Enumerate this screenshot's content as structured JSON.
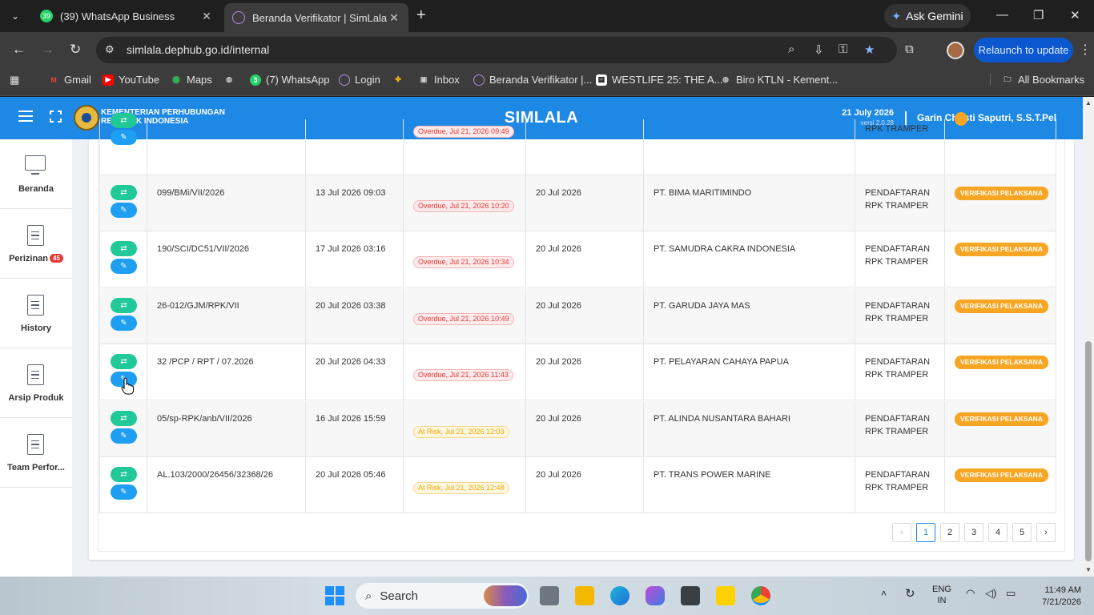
{
  "browser": {
    "tabs": [
      {
        "title": "(39) WhatsApp Business",
        "badge": "39",
        "active": false
      },
      {
        "title": "Beranda Verifikator | SimLala",
        "active": true
      }
    ],
    "gemini_label": "Ask Gemini",
    "url": "simlala.dephub.go.id/internal",
    "relaunch_label": "Relaunch to update",
    "bookmarks": [
      {
        "label": "Gmail",
        "icon": "gmail-icon"
      },
      {
        "label": "YouTube",
        "icon": "youtube-icon"
      },
      {
        "label": "Maps",
        "icon": "maps-icon"
      },
      {
        "label": "",
        "icon": "globe-icon"
      },
      {
        "label": "(7) WhatsApp",
        "icon": "whatsapp-icon"
      },
      {
        "label": "Login",
        "icon": "simlala-icon"
      },
      {
        "label": "",
        "icon": "pinwheel-icon"
      },
      {
        "label": "Inbox",
        "icon": "inbox-icon"
      },
      {
        "label": "Beranda Verifikator |...",
        "icon": "simlala-icon"
      },
      {
        "label": "WESTLIFE 25: THE A...",
        "icon": "page-icon"
      },
      {
        "label": "Biro KTLN - Kement...",
        "icon": "globe-icon"
      }
    ],
    "all_bookmarks_label": "All Bookmarks"
  },
  "header": {
    "org_line1": "KEMENTERIAN PERHUBUNGAN",
    "org_line2": "REPUBLIK INDONESIA",
    "app_title": "SIMLALA",
    "date": "21 July 2026",
    "version": "versi 2.0.28",
    "user": "Garin Christi Saputri, S.S.T.Pel"
  },
  "sidebar": {
    "items": [
      {
        "label": "Beranda",
        "icon": "monitor-icon"
      },
      {
        "label": "Perizinan",
        "icon": "document-icon",
        "badge": "45"
      },
      {
        "label": "History",
        "icon": "document-icon"
      },
      {
        "label": "Arsip Produk",
        "icon": "document-icon"
      },
      {
        "label": "Team Perfor...",
        "icon": "document-icon"
      }
    ]
  },
  "table": {
    "partial_row": {
      "sla": "Overdue, Jul 21, 2026 09:49",
      "type": "RPK TRAMPER"
    },
    "rows": [
      {
        "no": "099/BMi/VII/2026",
        "submitted": "13 Jul 2026 09:03",
        "sla": "Overdue, Jul 21, 2026 10:20",
        "sla_type": "overdue",
        "date": "20 Jul 2026",
        "company": "PT. BIMA MARITIMINDO",
        "type_line1": "PENDAFTARAN",
        "type_line2": "RPK TRAMPER",
        "status": "VERIFIKASI PELAKSANA"
      },
      {
        "no": "190/SCI/DC51/VII/2026",
        "submitted": "17 Jul 2026 03:16",
        "sla": "Overdue, Jul 21, 2026 10:34",
        "sla_type": "overdue",
        "date": "20 Jul 2026",
        "company": "PT. SAMUDRA CAKRA INDONESIA",
        "type_line1": "PENDAFTARAN",
        "type_line2": "RPK TRAMPER",
        "status": "VERIFIKASI PELAKSANA"
      },
      {
        "no": "26-012/GJM/RPK/VII",
        "submitted": "20 Jul 2026 03:38",
        "sla": "Overdue, Jul 21, 2026 10:49",
        "sla_type": "overdue",
        "date": "20 Jul 2026",
        "company": "PT. GARUDA JAYA MAS",
        "type_line1": "PENDAFTARAN",
        "type_line2": "RPK TRAMPER",
        "status": "VERIFIKASI PELAKSANA"
      },
      {
        "no": "32 /PCP / RPT / 07.2026",
        "submitted": "20 Jul 2026 04:33",
        "sla": "Overdue, Jul 21, 2026 11:43",
        "sla_type": "overdue",
        "date": "20 Jul 2026",
        "company": "PT. PELAYARAN CAHAYA PAPUA",
        "type_line1": "PENDAFTARAN",
        "type_line2": "RPK TRAMPER",
        "status": "VERIFIKASI PELAKSANA"
      },
      {
        "no": "05/sp-RPK/anb/VII/2026",
        "submitted": "16 Jul 2026 15:59",
        "sla": "At Risk, Jul 21, 2026 12:03",
        "sla_type": "risk",
        "date": "20 Jul 2026",
        "company": "PT. ALINDA NUSANTARA BAHARI",
        "type_line1": "PENDAFTARAN",
        "type_line2": "RPK TRAMPER",
        "status": "VERIFIKASI PELAKSANA"
      },
      {
        "no": "AL.103/2000/26456/32368/26",
        "submitted": "20 Jul 2026 05:46",
        "sla": "At Risk, Jul 21, 2026 12:48",
        "sla_type": "risk",
        "date": "20 Jul 2026",
        "company": "PT. TRANS POWER MARINE",
        "type_line1": "PENDAFTARAN",
        "type_line2": "RPK TRAMPER",
        "status": "VERIFIKASI PELAKSANA"
      }
    ]
  },
  "pagination": {
    "prev": "‹",
    "pages": [
      "1",
      "2",
      "3",
      "4",
      "5"
    ],
    "current": "1",
    "next": "›"
  },
  "taskbar": {
    "search_label": "Search",
    "lang_line1": "ENG",
    "lang_line2": "IN",
    "time": "11:49 AM",
    "date": "7/21/2026"
  },
  "colors": {
    "header_blue": "#1e88e5",
    "swap_button": "#20c997",
    "edit_button": "#1e9ff2",
    "status_orange": "#f6a623",
    "overdue_red": "#e53935",
    "at_risk_amber": "#f0a500"
  }
}
